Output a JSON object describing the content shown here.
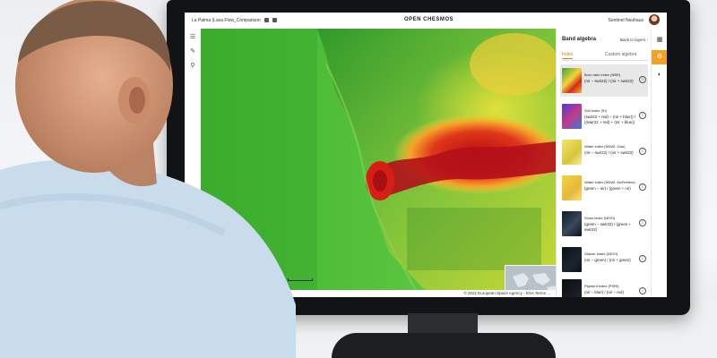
{
  "app": {
    "project_title": "La Palma (Lava Flow_Comparison",
    "brand": "OPEN CHESMOS",
    "user_name": "Sentinel Neuhaus"
  },
  "map": {
    "coordinates": "32°52'46\", 17.88840",
    "scale_label": "0.5 km",
    "attribution": "© 2021 European Space Agency - ESA Terms ...",
    "zoom_in": "+",
    "zoom_out": "−"
  },
  "panel": {
    "title": "Band algebra",
    "back_label": "Back to layers",
    "tabs": [
      {
        "label": "Index",
        "active": true
      },
      {
        "label": "Custom algebra",
        "active": false
      }
    ],
    "indices": [
      {
        "name": "Burn ratio index (NBR)",
        "formula": "(nir − swir22) / (nir + swir22)",
        "selected": true
      },
      {
        "name": "Soil index (SI)",
        "formula": "(swir22 + red) − (nir + blue)) / ((swir22 + red) + (nir + blue))",
        "selected": false
      },
      {
        "name": "Water index (NDWI, Gao)",
        "formula": "(nir − swir22) / (nir + swir22)",
        "selected": false
      },
      {
        "name": "Water index (NDWI, McFeeters)",
        "formula": "(green − nir) / (green + nir)",
        "selected": false
      },
      {
        "name": "Snow index (NDSI)",
        "formula": "(green − swir22) / (green + swir22)",
        "selected": false
      },
      {
        "name": "Glacier index (NDGI)",
        "formula": "(nir − green) / (nir + green)",
        "selected": false
      },
      {
        "name": "Pigment index (PSRI)",
        "formula": "(nir − blue) / (nir − red)",
        "selected": false
      }
    ],
    "info_glyph": "i"
  },
  "icons": {
    "left_tools": [
      "layers-icon",
      "pin-icon",
      "filter-icon"
    ],
    "right_tools": [
      "layers-icon",
      "band-algebra-icon",
      "contrast-icon"
    ]
  },
  "colors": {
    "accent": "#f0a326",
    "tab_active": "#e07a1f"
  }
}
